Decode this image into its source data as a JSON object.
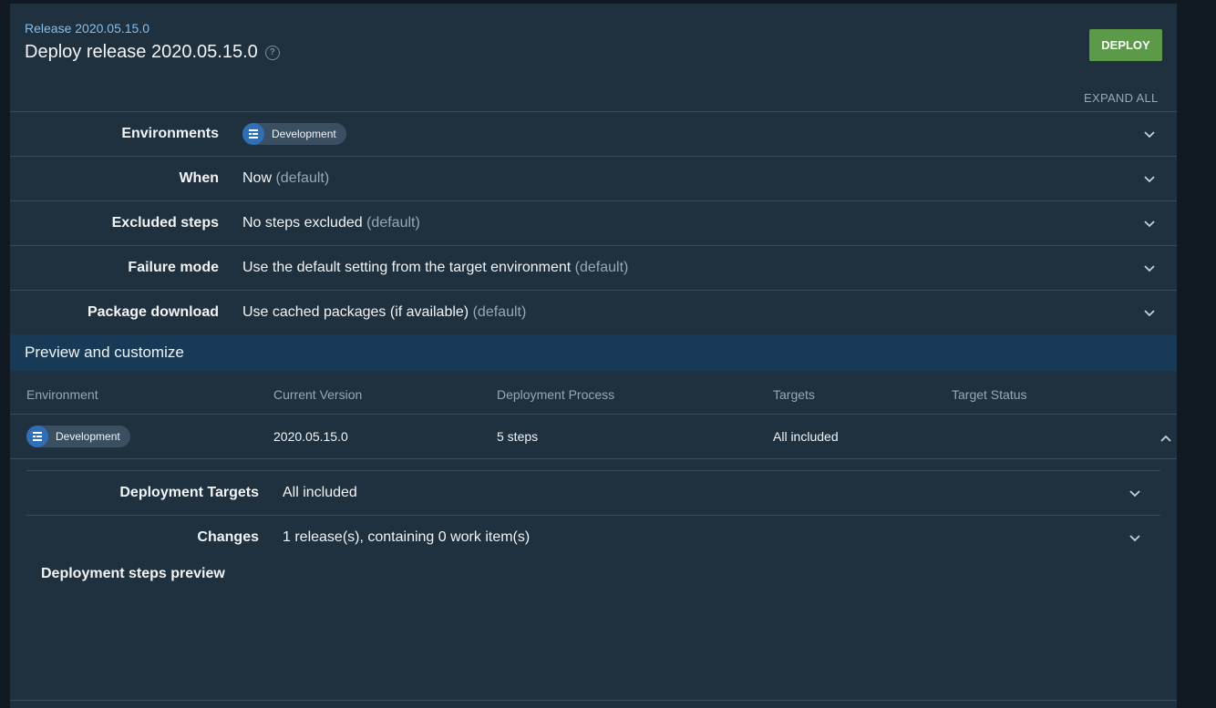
{
  "header": {
    "breadcrumb": "Release 2020.05.15.0",
    "title": "Deploy release 2020.05.15.0",
    "help_icon": "?",
    "deploy_label": "DEPLOY",
    "expand_all_label": "EXPAND ALL"
  },
  "options": [
    {
      "label": "Environments",
      "chip": "Development"
    },
    {
      "label": "When",
      "value": "Now",
      "hint": "(default)"
    },
    {
      "label": "Excluded steps",
      "value": "No steps excluded",
      "hint": "(default)"
    },
    {
      "label": "Failure mode",
      "value": "Use the default setting from the target environment",
      "hint": "(default)"
    },
    {
      "label": "Package download",
      "value": "Use cached packages (if available)",
      "hint": "(default)"
    }
  ],
  "preview": {
    "title": "Preview and customize",
    "columns": [
      "Environment",
      "Current Version",
      "Deployment Process",
      "Targets",
      "Target Status"
    ],
    "row": {
      "environment": "Development",
      "current_version": "2020.05.15.0",
      "deployment_process": "5 steps",
      "targets": "All included",
      "target_status": ""
    },
    "details": [
      {
        "label": "Deployment Targets",
        "value": "All included"
      },
      {
        "label": "Changes",
        "value": "1 release(s), containing 0 work item(s)"
      }
    ],
    "steps_preview_title": "Deployment steps preview"
  },
  "colors": {
    "background": "#1f303f",
    "section_header": "#193a56",
    "deploy_button": "#5a9a48",
    "link": "#87bfec",
    "env_icon": "#2f6fb5"
  },
  "icons": {
    "help": "help-circle-icon",
    "expand": "chevron-down-icon",
    "collapse": "chevron-up-icon",
    "environment": "environment-icon"
  }
}
